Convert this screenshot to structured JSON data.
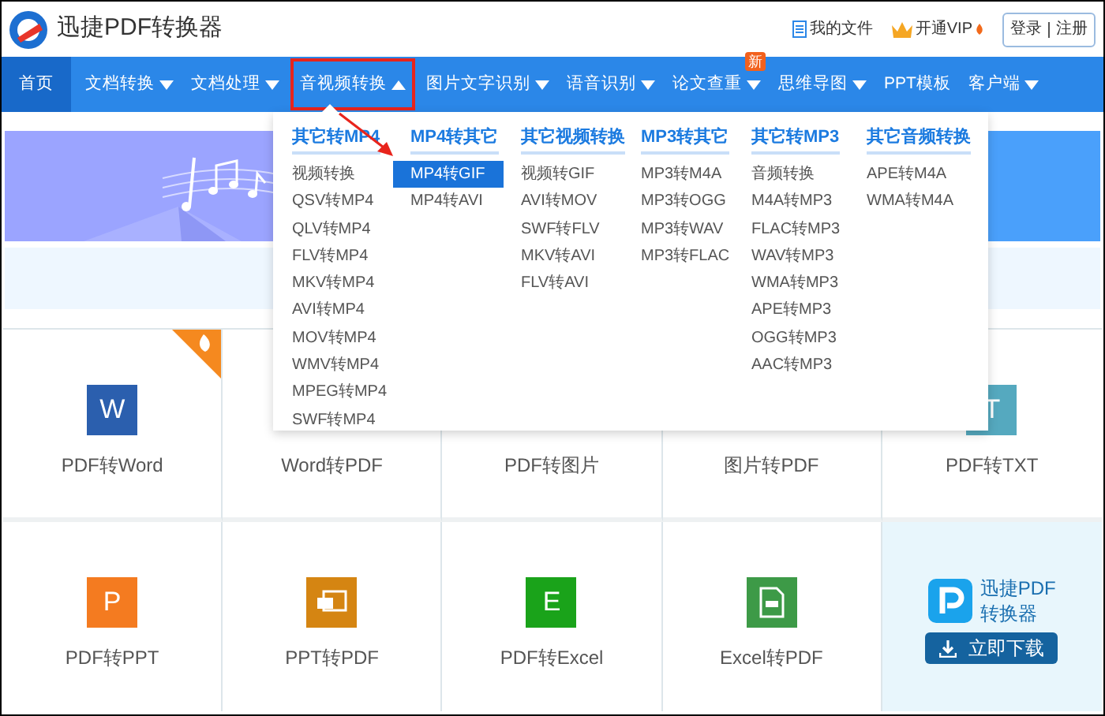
{
  "header": {
    "title": "迅捷PDF转换器",
    "links": [
      {
        "kind": "files",
        "label": "我的文件"
      },
      {
        "kind": "vip",
        "label": "开通VIP"
      }
    ],
    "login": "登录",
    "register": "注册"
  },
  "nav": [
    {
      "label": "首页",
      "kind": "link",
      "selected": true,
      "highlighted": false
    },
    {
      "label": "文档转换",
      "kind": "menu",
      "selected": false,
      "expanded": false,
      "highlighted": false
    },
    {
      "label": "文档处理",
      "kind": "menu",
      "selected": false,
      "expanded": false,
      "highlighted": false
    },
    {
      "label": "音视频转换",
      "kind": "menu",
      "selected": false,
      "expanded": true,
      "highlighted": true
    },
    {
      "label": "图片文字识别",
      "kind": "menu",
      "selected": false,
      "expanded": false,
      "highlighted": false
    },
    {
      "label": "语音识别",
      "kind": "menu",
      "selected": false,
      "expanded": false,
      "highlighted": false
    },
    {
      "label": "论文查重",
      "kind": "menu",
      "selected": false,
      "expanded": false,
      "highlighted": false,
      "badge": "新"
    },
    {
      "label": "思维导图",
      "kind": "menu",
      "selected": false,
      "expanded": false,
      "highlighted": false
    },
    {
      "label": "PPT模板",
      "kind": "link",
      "selected": false,
      "highlighted": false
    },
    {
      "label": "客户端",
      "kind": "menu",
      "selected": false,
      "expanded": false,
      "highlighted": false
    }
  ],
  "dropdown": {
    "columns": [
      {
        "heading": "其它转MP4",
        "items": [
          {
            "label": "视频转换",
            "selected": false
          },
          {
            "label": "QSV转MP4",
            "selected": false
          },
          {
            "label": "QLV转MP4",
            "selected": false
          },
          {
            "label": "FLV转MP4",
            "selected": false
          },
          {
            "label": "MKV转MP4",
            "selected": false
          },
          {
            "label": "AVI转MP4",
            "selected": false
          },
          {
            "label": "MOV转MP4",
            "selected": false
          },
          {
            "label": "WMV转MP4",
            "selected": false
          },
          {
            "label": "MPEG转MP4",
            "selected": false
          },
          {
            "label": "SWF转MP4",
            "selected": false
          }
        ]
      },
      {
        "heading": "MP4转其它",
        "items": [
          {
            "label": "MP4转GIF",
            "selected": true
          },
          {
            "label": "MP4转AVI",
            "selected": false
          }
        ]
      },
      {
        "heading": "其它视频转换",
        "items": [
          {
            "label": "视频转GIF",
            "selected": false
          },
          {
            "label": "AVI转MOV",
            "selected": false
          },
          {
            "label": "SWF转FLV",
            "selected": false
          },
          {
            "label": "MKV转AVI",
            "selected": false
          },
          {
            "label": "FLV转AVI",
            "selected": false
          }
        ]
      },
      {
        "heading": "MP3转其它",
        "items": [
          {
            "label": "MP3转M4A",
            "selected": false
          },
          {
            "label": "MP3转OGG",
            "selected": false
          },
          {
            "label": "MP3转WAV",
            "selected": false
          },
          {
            "label": "MP3转FLAC",
            "selected": false
          }
        ]
      },
      {
        "heading": "其它转MP3",
        "items": [
          {
            "label": "音频转换",
            "selected": false
          },
          {
            "label": "M4A转MP3",
            "selected": false
          },
          {
            "label": "FLAC转MP3",
            "selected": false
          },
          {
            "label": "WAV转MP3",
            "selected": false
          },
          {
            "label": "WMA转MP3",
            "selected": false
          },
          {
            "label": "APE转MP3",
            "selected": false
          },
          {
            "label": "OGG转MP3",
            "selected": false
          },
          {
            "label": "AAC转MP3",
            "selected": false
          }
        ]
      },
      {
        "heading": "其它音频转换",
        "items": [
          {
            "label": "APE转M4A",
            "selected": false
          },
          {
            "label": "WMA转M4A",
            "selected": false
          }
        ]
      }
    ]
  },
  "cards": [
    {
      "kind": "letter",
      "label": "PDF转Word",
      "letter": "W",
      "color": "#2b5fae",
      "hot": true
    },
    {
      "kind": "plain",
      "label": "Word转PDF",
      "hot": false
    },
    {
      "kind": "plain",
      "label": "PDF转图片",
      "hot": false
    },
    {
      "kind": "plain",
      "label": "图片转PDF",
      "hot": false
    },
    {
      "kind": "letter",
      "label": "PDF转TXT",
      "letter": "T",
      "color": "#55a9bf",
      "hot": false
    },
    {
      "kind": "letter",
      "label": "PDF转PPT",
      "letter": "P",
      "color": "#f47b20",
      "hot": false
    },
    {
      "kind": "slide",
      "label": "PPT转PDF",
      "color": "#d58512",
      "hot": false
    },
    {
      "kind": "letter",
      "label": "PDF转Excel",
      "letter": "E",
      "color": "#1aa31a",
      "hot": false
    },
    {
      "kind": "doc",
      "label": "Excel转PDF",
      "color": "#3d9a47",
      "hot": false
    },
    {
      "kind": "download",
      "title_lines": [
        "迅捷PDF",
        "转换器"
      ],
      "button": "立即下载"
    }
  ]
}
